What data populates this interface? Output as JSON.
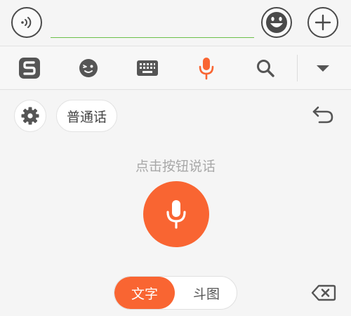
{
  "chat_bar": {
    "voice_toggle_icon": "voice-wave-icon",
    "input_value": "",
    "input_placeholder": "",
    "emoji_icon": "smile-emoji-icon",
    "plus_icon": "plus-icon"
  },
  "toolbar": {
    "items": [
      {
        "name": "sogou-logo-icon"
      },
      {
        "name": "emoji-face-icon"
      },
      {
        "name": "keyboard-icon"
      },
      {
        "name": "microphone-icon",
        "active": true
      },
      {
        "name": "search-icon"
      },
      {
        "name": "collapse-arrow-icon"
      }
    ]
  },
  "panel": {
    "language_label": "普通话",
    "hint": "点击按钮说话",
    "modes": {
      "text_label": "文字",
      "doutu_label": "斗图",
      "selected": "文字"
    }
  },
  "colors": {
    "accent": "#f96532",
    "input_underline": "#6cc04a",
    "icon_gray": "#555555"
  }
}
